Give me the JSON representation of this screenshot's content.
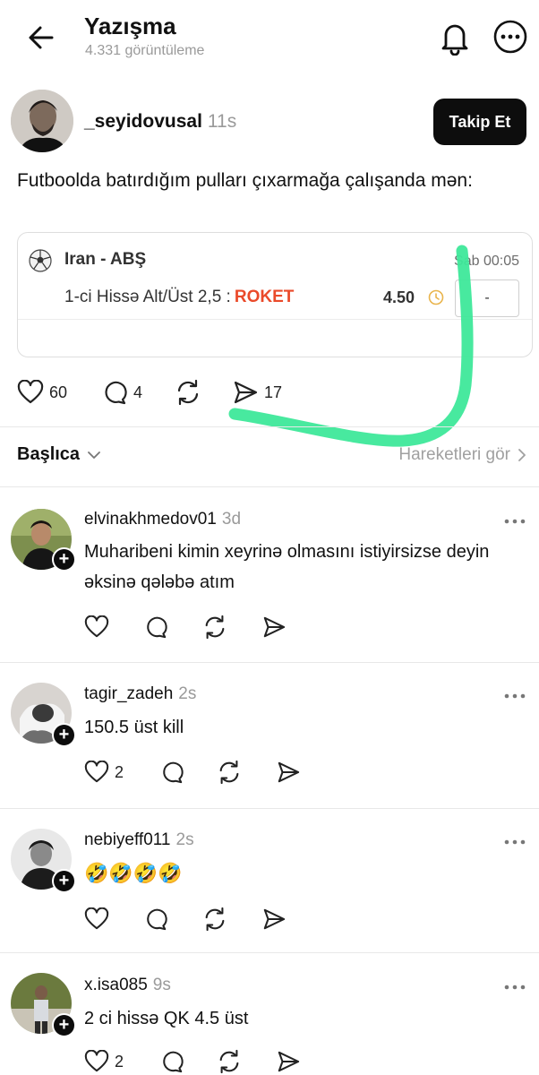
{
  "header": {
    "title": "Yazışma",
    "views": "4.331 görüntüleme"
  },
  "post": {
    "username": "_seyidovusal",
    "time": "11s",
    "follow_label": "Takip Et",
    "text": "Futboolda batırdığım pulları çıxarmağa çalışanda mən:",
    "bet": {
      "match": "Iran - ABŞ",
      "time": "Sab   00:05",
      "market": "1-ci Hissə Alt/Üst 2,5 :",
      "tag": "ROKET",
      "odds": "4.50",
      "selection": "-"
    },
    "likes": "60",
    "comments": "4",
    "shares": "17"
  },
  "sort": {
    "label": "Başlıca",
    "activity_label": "Hareketleri gör"
  },
  "replies": [
    {
      "username": "elvinakhmedov01",
      "time": "3d",
      "text": "Muharibeni kimin xeyrinə olmasını istiyirsizse deyin əksinə qələbə atım",
      "likes": ""
    },
    {
      "username": "tagir_zadeh",
      "time": "2s",
      "text": "150.5 üst kill",
      "likes": "2"
    },
    {
      "username": "nebiyeff011",
      "time": "2s",
      "text": "🤣🤣🤣🤣",
      "likes": ""
    },
    {
      "username": "x.isa085",
      "time": "9s",
      "text": "2 ci hissə QK 4.5 üst",
      "likes": "2"
    }
  ],
  "colors": {
    "accent_green": "#3ee89a",
    "roket_red": "#ea4a2a",
    "follow_button": "#0d0d0d"
  },
  "icons": [
    "back-arrow-icon",
    "bell-icon",
    "more-options-icon",
    "heart-icon",
    "comment-icon",
    "repost-icon",
    "send-icon",
    "chevron-down-icon",
    "chevron-right-icon",
    "soccer-ball-icon",
    "clock-icon",
    "plus-icon"
  ]
}
